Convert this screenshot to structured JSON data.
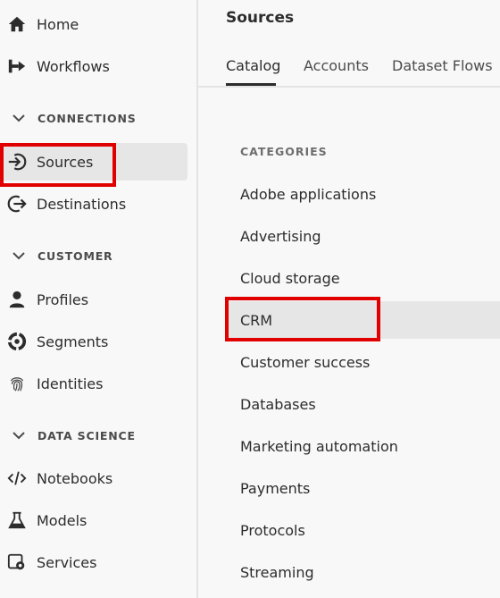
{
  "sidebar": {
    "items": [
      {
        "label": "Home",
        "icon": "home-icon"
      },
      {
        "label": "Workflows",
        "icon": "workflows-icon"
      },
      {
        "label": "Sources",
        "icon": "sources-icon"
      },
      {
        "label": "Destinations",
        "icon": "destinations-icon"
      },
      {
        "label": "Profiles",
        "icon": "profiles-icon"
      },
      {
        "label": "Segments",
        "icon": "segments-icon"
      },
      {
        "label": "Identities",
        "icon": "identities-icon"
      },
      {
        "label": "Notebooks",
        "icon": "notebooks-icon"
      },
      {
        "label": "Models",
        "icon": "models-icon"
      },
      {
        "label": "Services",
        "icon": "services-icon"
      }
    ],
    "sections": [
      {
        "label": "CONNECTIONS"
      },
      {
        "label": "CUSTOMER"
      },
      {
        "label": "DATA SCIENCE"
      }
    ],
    "selected": "Sources"
  },
  "main": {
    "title": "Sources",
    "tabs": [
      {
        "label": "Catalog"
      },
      {
        "label": "Accounts"
      },
      {
        "label": "Dataset Flows"
      }
    ],
    "active_tab": "Catalog",
    "categories_heading": "CATEGORIES",
    "categories": [
      {
        "label": "Adobe applications"
      },
      {
        "label": "Advertising"
      },
      {
        "label": "Cloud storage"
      },
      {
        "label": "CRM"
      },
      {
        "label": "Customer success"
      },
      {
        "label": "Databases"
      },
      {
        "label": "Marketing automation"
      },
      {
        "label": "Payments"
      },
      {
        "label": "Protocols"
      },
      {
        "label": "Streaming"
      }
    ],
    "selected_category": "CRM"
  },
  "colors": {
    "highlight": "#e10000",
    "selected_bg": "#e6e6e6",
    "background": "#f8f8f8"
  }
}
